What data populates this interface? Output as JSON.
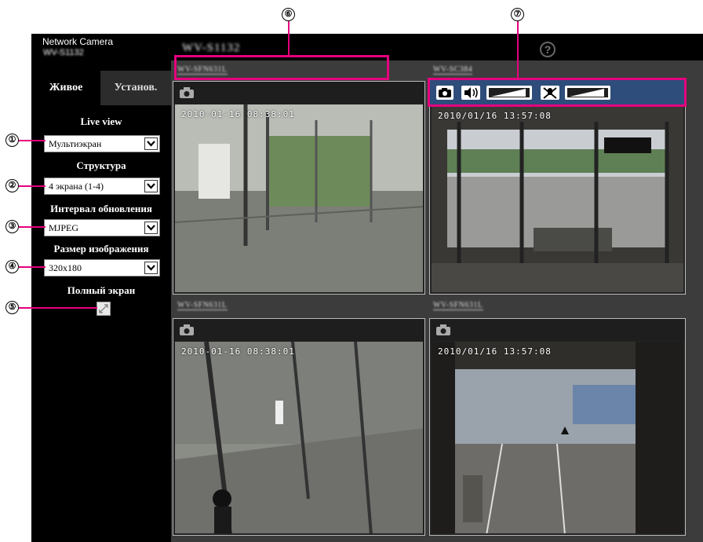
{
  "header": {
    "brand": "Network Camera",
    "model_short": "WV-S1132",
    "model": "WV-S1132",
    "help_symbol": "?"
  },
  "tabs": {
    "live": "Живое",
    "setup": "Установ."
  },
  "sidebar": {
    "live_view_label": "Live view",
    "live_view_value": "Мультиэкран",
    "structure_label": "Структура",
    "structure_value": "4 экрана (1-4)",
    "refresh_label": "Интервал обновления",
    "refresh_value": "MJPEG",
    "image_size_label": "Размер изображения",
    "image_size_value": "320x180",
    "fullscreen_label": "Полный экран"
  },
  "callouts": [
    "①",
    "②",
    "③",
    "④",
    "⑤",
    "⑥",
    "⑦"
  ],
  "cameras": [
    {
      "title": "WV-SFN631L",
      "timestamp": "2010-01-16 08:38:01"
    },
    {
      "title": "WV-SC384",
      "timestamp": "2010/01/16 13:57:08"
    },
    {
      "title": "WV-SFN631L",
      "timestamp": "2010-01-16 08:38:01"
    },
    {
      "title": "WV-SFN631L",
      "timestamp": "2010/01/16 13:57:08"
    }
  ],
  "icons": [
    "help-icon",
    "camera-icon",
    "speaker-icon",
    "volume-bar-icon",
    "mic-muted-icon",
    "fullscreen-icon",
    "dropdown-arrow-icon"
  ],
  "colors": {
    "accent": "#e6007e",
    "toolbar_highlight": "#2e4d7a",
    "sidebar": "#000000",
    "main_bg": "#3c3c3c"
  }
}
